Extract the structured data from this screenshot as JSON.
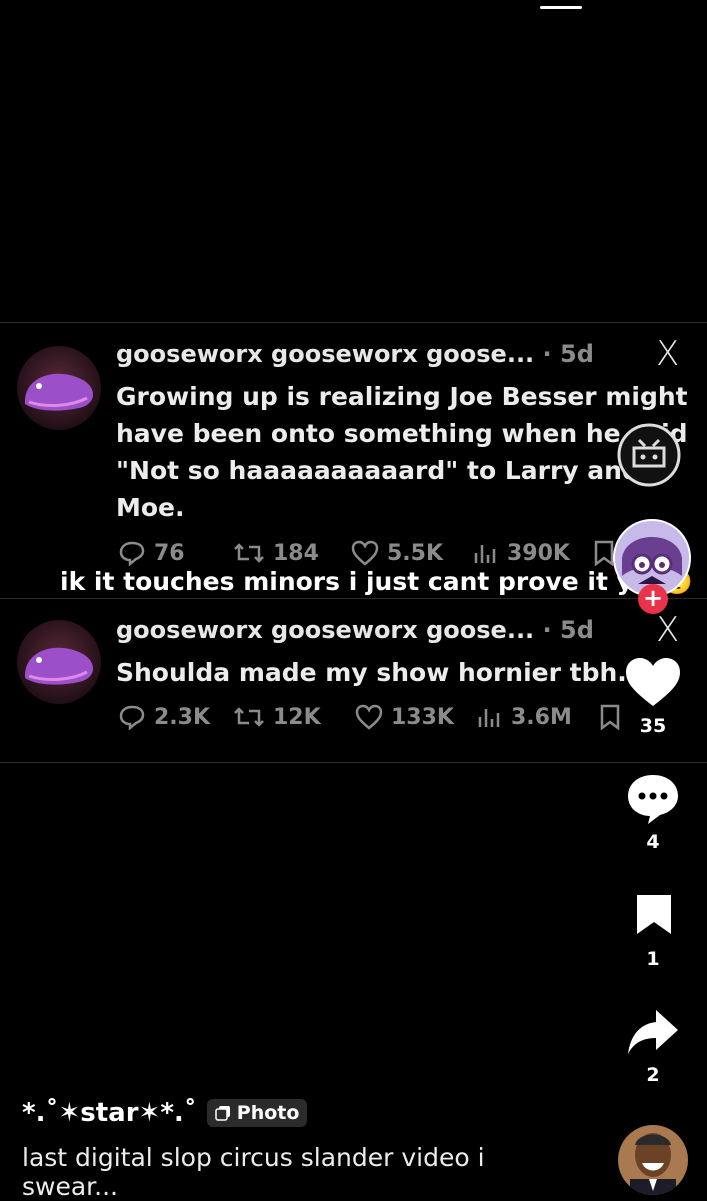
{
  "tweets": [
    {
      "author": "gooseworx gooseworx goose...",
      "separator": "·",
      "time": "5d",
      "text_lines": [
        "Growing up is realizing Joe Besser might",
        "have been onto something when he said",
        "\"Not so haaaaaaaaaard\" to Larry and",
        "Moe."
      ],
      "replies": "76",
      "retweets": "184",
      "likes": "5.5K",
      "views": "390K"
    },
    {
      "author": "gooseworx gooseworx goose...",
      "separator": "·",
      "time": "5d",
      "text_lines": [
        "Shoulda made my show hornier tbh."
      ],
      "replies": "2.3K",
      "retweets": "12K",
      "likes": "133K",
      "views": "3.6M"
    }
  ],
  "x_logo": "X",
  "overlay_caption": "ik it touches minors i just cant prove it yet",
  "overlay_emoji": "🤨",
  "sidebar": {
    "likes_count": "35",
    "comments_count": "4",
    "bookmarks_count": "1",
    "shares_count": "2",
    "follow_plus": "+"
  },
  "post": {
    "author": "*.˚✶star✶*.˚",
    "badge": "Photo",
    "description_lines": [
      "last digital slop circus slander video i",
      "swear..."
    ]
  },
  "colors": {
    "background": "#000000",
    "muted": "#8b8b8b",
    "follow": "#e8334a"
  }
}
